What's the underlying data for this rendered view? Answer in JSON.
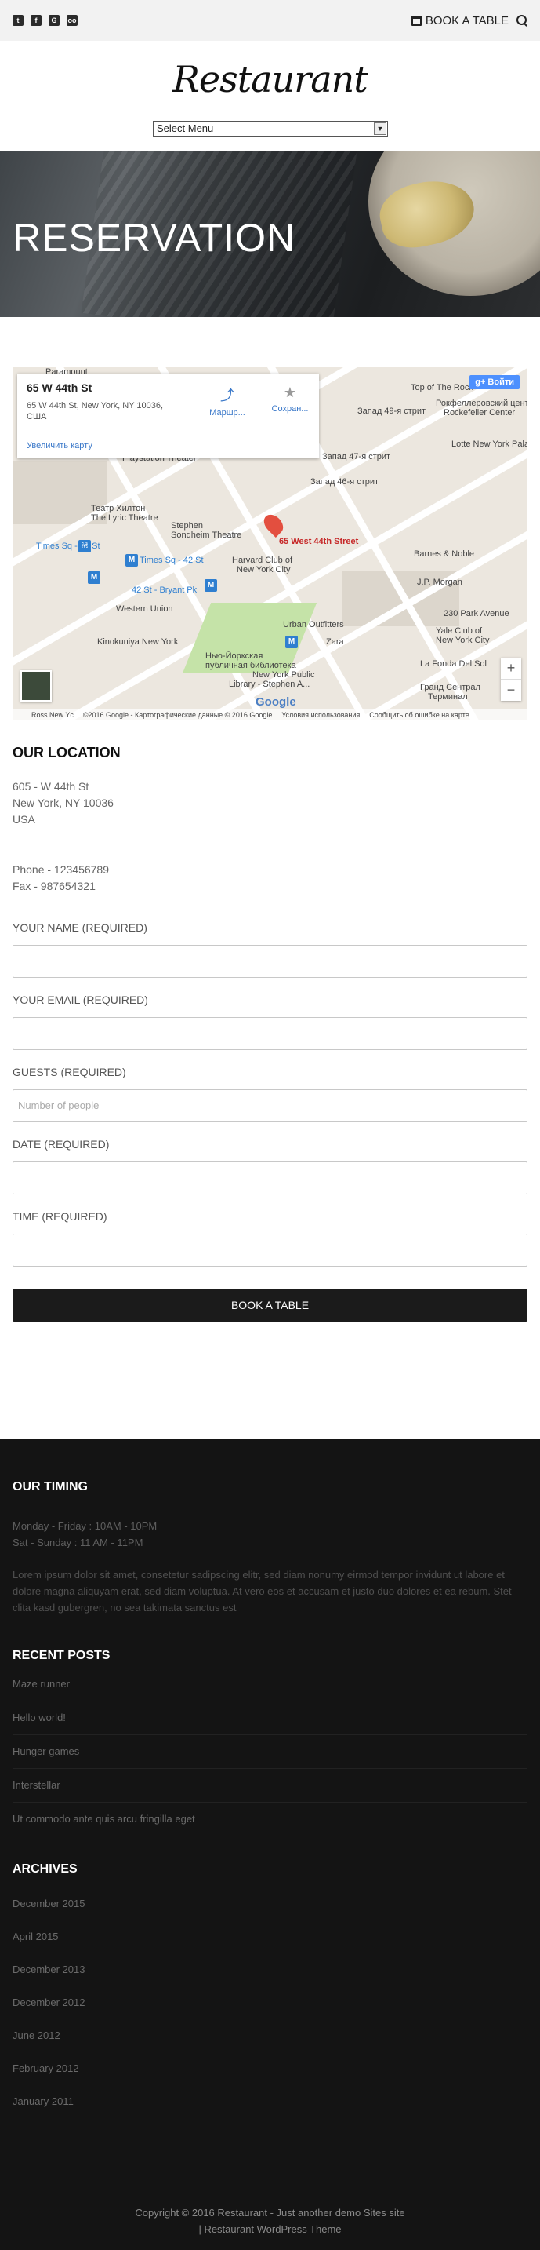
{
  "topbar": {
    "social": [
      {
        "icon": "twitter-icon",
        "glyph": "t"
      },
      {
        "icon": "facebook-icon",
        "glyph": "f"
      },
      {
        "icon": "google-plus-icon",
        "glyph": "G"
      },
      {
        "icon": "tripadvisor-icon",
        "glyph": "oo"
      }
    ],
    "book_label": "BOOK A TABLE"
  },
  "header": {
    "logo": "Restaurant",
    "menu_select": "Select Menu"
  },
  "hero": {
    "title": "RESERVATION"
  },
  "map": {
    "card_title": "65 W 44th St",
    "card_address": "65 W 44th St, New York, NY 10036, США",
    "card_enlarge": "Увеличить карту",
    "action_route": "Маршр...",
    "action_save": "Сохран...",
    "signin": "Войти",
    "pin_label": "65 West 44th Street",
    "labels": [
      "Театр Хилтон",
      "The Lyric Theatre",
      "Stephen",
      "Sondheim Theatre",
      "Times Sq - 42 St",
      "Times Sq - 42 St",
      "42 St - Bryant Pk",
      "Harvard Club of",
      "New York City",
      "Western Union",
      "Kinokuniya New York",
      "Urban Outfitters",
      "Zara",
      "Нью-Йоркская",
      "публичная библиотека",
      "New York Public",
      "Library - Stephen A...",
      "Barnes & Noble",
      "J.P. Morgan",
      "Top of The Rock",
      "Рокфеллеровский центр",
      "Rockefeller Center",
      "Lotte New York Palace",
      "Yale Club of",
      "New York City",
      "La Fonda Del Sol",
      "Гранд Сентрал",
      "Терминал",
      "230 Park Avenue",
      "Paramount",
      "Playstation Theater",
      "Запад 49-я стрит",
      "Запад 47-я стрит",
      "Запад 46-я стрит"
    ],
    "footer": [
      "Ross New Yc",
      "©2016 Google - Картографические данные © 2016 Google",
      "Условия использования",
      "Сообщить об ошибке на карте"
    ],
    "google_logo": "Google"
  },
  "location": {
    "heading": "OUR LOCATION",
    "address": [
      "605 - W 44th St",
      "New York, NY 10036",
      "USA"
    ],
    "phone": "Phone - 123456789",
    "fax": "Fax - 987654321"
  },
  "form": {
    "name_label": "YOUR NAME (REQUIRED)",
    "email_label": "YOUR EMAIL (REQUIRED)",
    "guests_label": "GUESTS (REQUIRED)",
    "guests_placeholder": "Number of people",
    "date_label": "DATE (REQUIRED)",
    "time_label": "TIME (REQUIRED)",
    "submit_label": "BOOK A TABLE"
  },
  "footer": {
    "timing_heading": "OUR TIMING",
    "timing_weekdays": "Monday - Friday : 10AM - 10PM",
    "timing_weekend": "Sat - Sunday : 11 AM - 11PM",
    "lorem": "Lorem ipsum dolor sit amet, consetetur sadipscing elitr, sed diam nonumy eirmod tempor invidunt ut labore et dolore magna aliquyam erat, sed diam voluptua. At vero eos et accusam et justo duo dolores et ea rebum. Stet clita kasd gubergren, no sea takimata sanctus est",
    "recent_heading": "RECENT POSTS",
    "posts": [
      "Maze runner",
      "Hello world!",
      "Hunger games",
      "Interstellar",
      "Ut commodo ante quis arcu fringilla eget"
    ],
    "archives_heading": "ARCHIVES",
    "archives": [
      "December 2015",
      "April 2015",
      "December 2013",
      "December 2012",
      "June 2012",
      "February 2012",
      "January 2011"
    ],
    "copyright_line1": "Copyright © 2016 Restaurant - Just another demo Sites site",
    "copyright_line2": "| Restaurant WordPress Theme"
  }
}
